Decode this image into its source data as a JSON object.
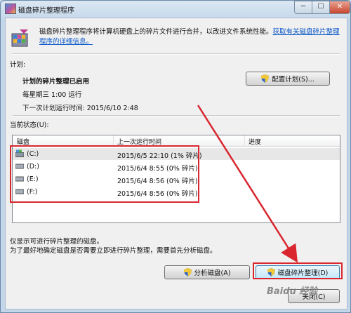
{
  "window": {
    "title": "磁盘碎片整理程序",
    "minimize": "─",
    "maximize": "☐",
    "close": "✕"
  },
  "intro": {
    "text": "磁盘碎片整理程序将计算机硬盘上的碎片文件进行合并，以改进文件系统性能。",
    "link": "获取有关磁盘碎片整理程序的详细信息。"
  },
  "schedule": {
    "section_label": "计划:",
    "status": "计划的碎片整理已启用",
    "frequency": "每星期三 1:00 运行",
    "next_run": "下一次计划运行时间: 2015/6/10 2:48",
    "configure_button": "配置计划(S)..."
  },
  "current_status": {
    "label": "当前状态(U):",
    "columns": [
      "磁盘",
      "上一次运行时间",
      "进度"
    ],
    "rows": [
      {
        "disk": "(C:)",
        "last_run": "2015/6/5 22:10 (1% 碎片)",
        "progress": ""
      },
      {
        "disk": "(D:)",
        "last_run": "2015/6/4 8:55 (0% 碎片)",
        "progress": ""
      },
      {
        "disk": "(E:)",
        "last_run": "2015/6/4 8:56 (0% 碎片)",
        "progress": ""
      },
      {
        "disk": "(F:)",
        "last_run": "2015/6/4 8:56 (0% 碎片)",
        "progress": ""
      }
    ]
  },
  "footer": {
    "note1": "仅显示可进行碎片整理的磁盘。",
    "note2": "为了最好地确定磁盘是否需要立即进行碎片整理，需要首先分析磁盘。",
    "analyze_button": "分析磁盘(A)",
    "defrag_button": "磁盘碎片整理(D)",
    "close_button": "关闭(C)"
  },
  "watermark": "Baidu 经验",
  "colors": {
    "highlight": "#d9262f",
    "link": "#0a57c9"
  },
  "icons": [
    "defrag-app-icon",
    "shield-icon",
    "drive-icon",
    "system-drive-icon"
  ]
}
